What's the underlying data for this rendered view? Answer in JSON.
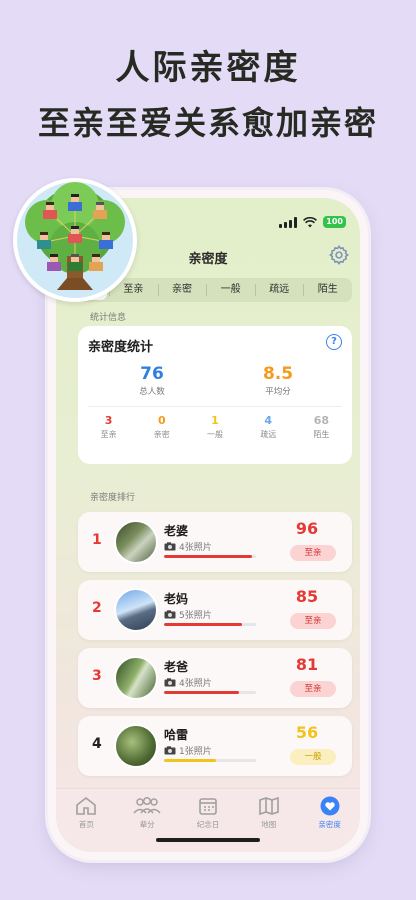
{
  "headline": {
    "line1": "人际亲密度",
    "line2": "至亲至爱关系愈加亲密"
  },
  "status_bar": {
    "battery": "100"
  },
  "nav": {
    "title": "亲密度"
  },
  "filter_tabs": [
    {
      "label": ""
    },
    {
      "label": "至亲"
    },
    {
      "label": "亲密"
    },
    {
      "label": "一般"
    },
    {
      "label": "疏远"
    },
    {
      "label": "陌生"
    }
  ],
  "stats": {
    "section_label": "统计信息",
    "title": "亲密度统计",
    "help": "?",
    "total": {
      "value": "76",
      "label": "总人数",
      "color": "#2f7fe0"
    },
    "average": {
      "value": "8.5",
      "label": "平均分",
      "color": "#f59a1b"
    },
    "tiers": [
      {
        "count": "3",
        "name": "至亲",
        "color": "#e53935"
      },
      {
        "count": "0",
        "name": "亲密",
        "color": "#f59a1b"
      },
      {
        "count": "1",
        "name": "一般",
        "color": "#f2c31b"
      },
      {
        "count": "4",
        "name": "疏远",
        "color": "#6aa6ea"
      },
      {
        "count": "68",
        "name": "陌生",
        "color": "#b5b5b5"
      }
    ]
  },
  "ranking": {
    "section_label": "亲密度排行",
    "items": [
      {
        "rank": "1",
        "name": "老婆",
        "photos": "4张照片",
        "score": "96",
        "level": "至亲",
        "progress": 0.96,
        "rank_color": "#e53935",
        "score_color": "#e53935",
        "bar_color": "#e53935",
        "badge_bg": "#fbd3d3",
        "badge_fg": "#d32f2f"
      },
      {
        "rank": "2",
        "name": "老妈",
        "photos": "5张照片",
        "score": "85",
        "level": "至亲",
        "progress": 0.85,
        "rank_color": "#e53935",
        "score_color": "#e53935",
        "bar_color": "#e53935",
        "badge_bg": "#fbd3d3",
        "badge_fg": "#d32f2f"
      },
      {
        "rank": "3",
        "name": "老爸",
        "photos": "4张照片",
        "score": "81",
        "level": "至亲",
        "progress": 0.81,
        "rank_color": "#e53935",
        "score_color": "#e53935",
        "bar_color": "#e53935",
        "badge_bg": "#fbd3d3",
        "badge_fg": "#d32f2f"
      },
      {
        "rank": "4",
        "name": "哈雷",
        "photos": "1张照片",
        "score": "56",
        "level": "一般",
        "progress": 0.56,
        "rank_color": "#222222",
        "score_color": "#f2c31b",
        "bar_color": "#f2c31b",
        "badge_bg": "#fbefbf",
        "badge_fg": "#c9a100"
      }
    ]
  },
  "tab_bar": [
    {
      "label": "首页",
      "icon": "home-icon"
    },
    {
      "label": "辈分",
      "icon": "people-icon"
    },
    {
      "label": "纪念日",
      "icon": "calendar-icon"
    },
    {
      "label": "地图",
      "icon": "map-icon"
    },
    {
      "label": "亲密度",
      "icon": "heart-icon",
      "active": true
    }
  ],
  "colors": {
    "accent": "#3b82f6",
    "background": "#e4dcf6"
  }
}
